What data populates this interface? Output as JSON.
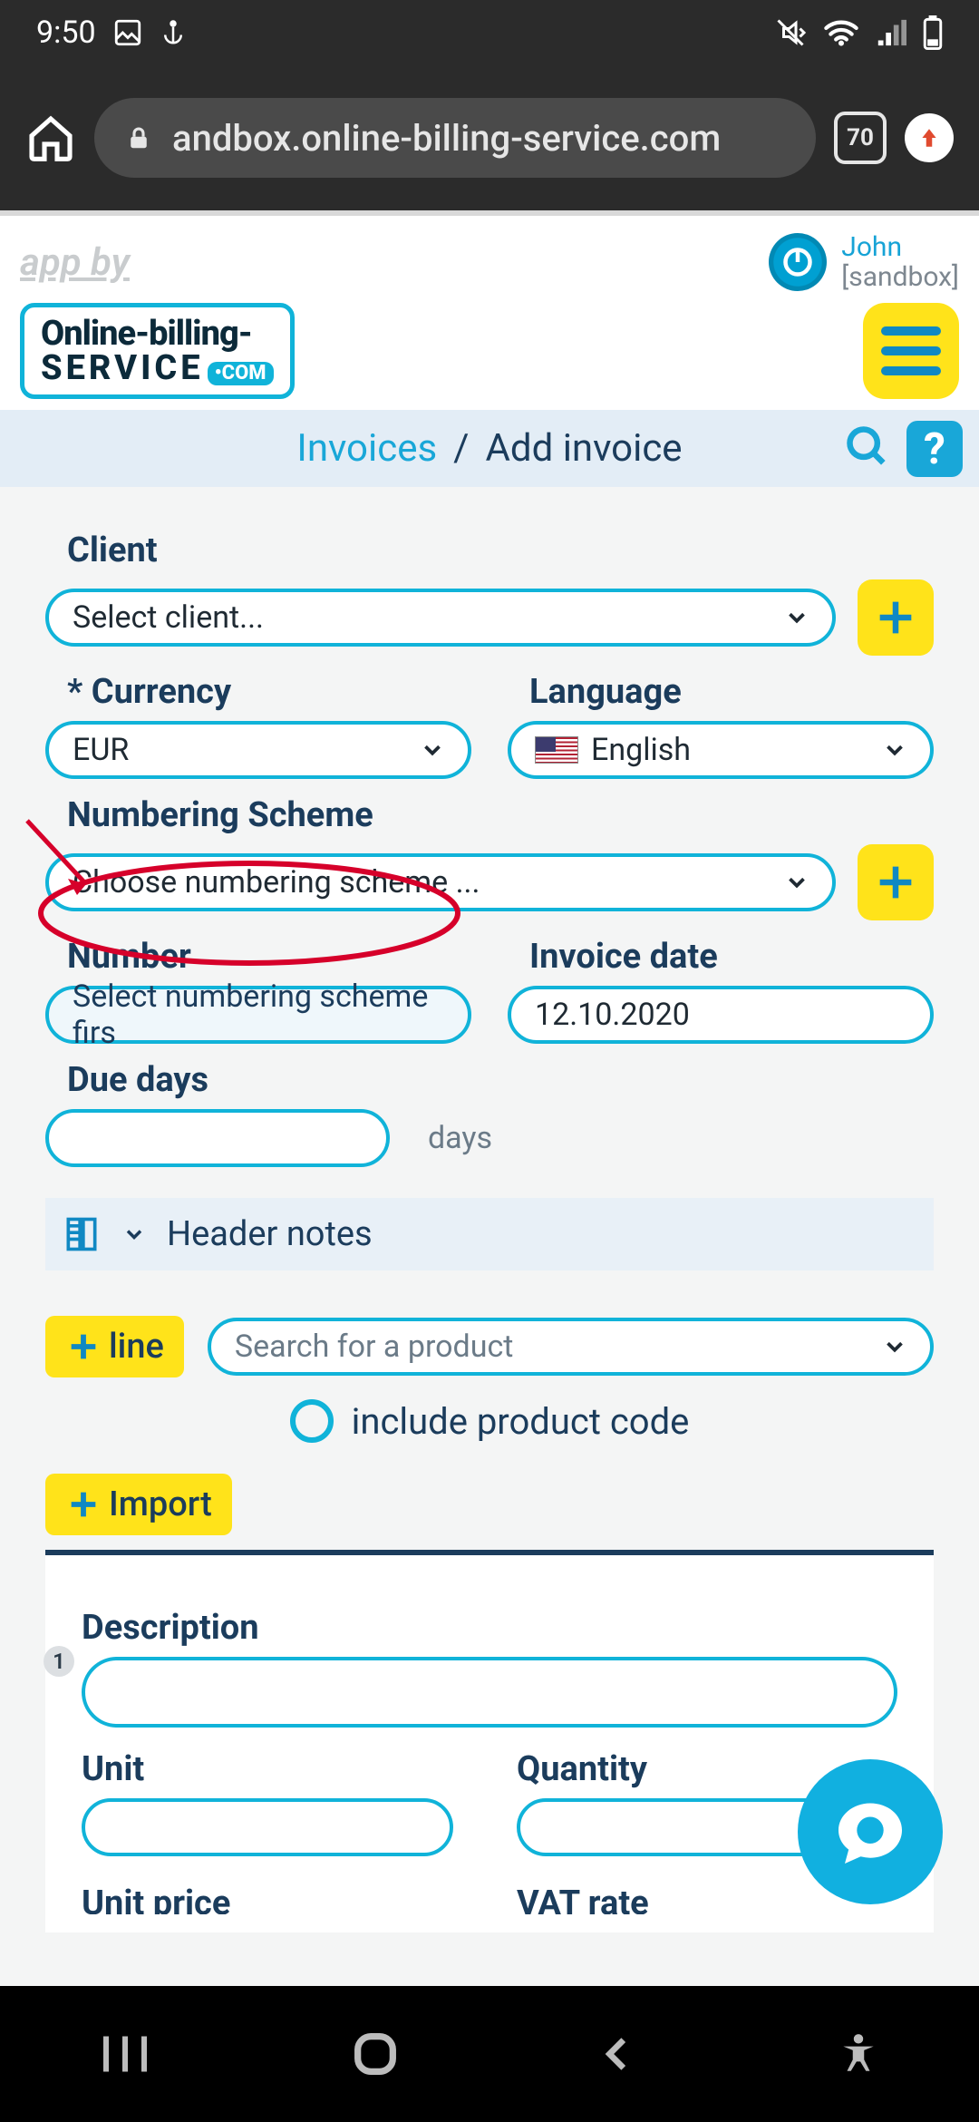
{
  "status": {
    "time": "9:50"
  },
  "browser": {
    "url_display": "andbox.online-billing-service.com",
    "tab_count": "70"
  },
  "header": {
    "app_by": "app by",
    "logo_line1": "Online-billing-",
    "logo_line2": "SERVICE",
    "logo_dotcom": "•com",
    "user_name": "John",
    "user_context": "[sandbox]"
  },
  "breadcrumb": {
    "link": "Invoices",
    "sep": "/",
    "current": "Add invoice",
    "help": "?"
  },
  "form": {
    "client_label": "Client",
    "client_value": "Select client...",
    "currency_label": "* Currency",
    "currency_value": "EUR",
    "language_label": "Language",
    "language_value": "English",
    "scheme_label": "Numbering Scheme",
    "scheme_value": "Choose numbering scheme ...",
    "number_label": "Number",
    "number_value": "Select numbering scheme firs",
    "date_label": "Invoice date",
    "date_value": "12.10.2020",
    "due_label": "Due days",
    "due_suffix": "days",
    "header_notes": "Header notes"
  },
  "lines": {
    "add_line_label": "line",
    "product_placeholder": "Search for a product",
    "include_code_label": "include product code",
    "import_label": "Import"
  },
  "item": {
    "row_num": "1",
    "desc_label": "Description",
    "unit_label": "Unit",
    "qty_label": "Quantity",
    "price_label": "Unit price",
    "vat_label": "VAT rate"
  }
}
